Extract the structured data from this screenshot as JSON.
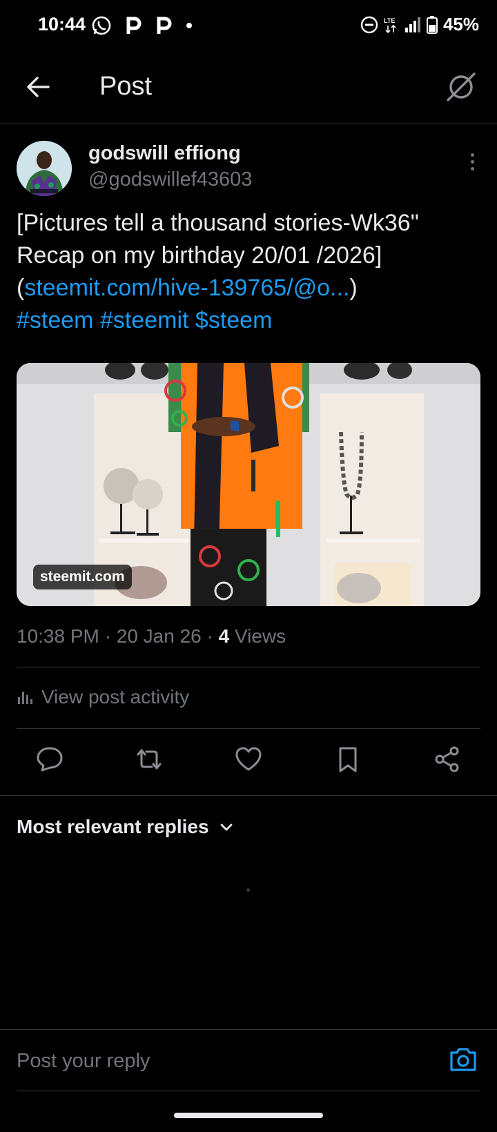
{
  "status_bar": {
    "time": "10:44",
    "battery_percent": "45%",
    "icons": [
      "whatsapp-icon",
      "p-app-icon",
      "p-app-icon",
      "notification-dot",
      "dnd-icon",
      "lte-icon",
      "signal-icon",
      "battery-icon"
    ]
  },
  "header": {
    "title": "Post",
    "back_icon": "arrow-left-icon",
    "grok_icon": "grok-icon"
  },
  "author": {
    "name": "godswill effiong",
    "handle": "@godswillef43603"
  },
  "post": {
    "text_part1": "[Pictures tell a thousand stories-Wk36\" Recap on my birthday 20/01 /2026](",
    "link_text": "steemit.com/hive-139765/@o...",
    "text_part2": ")",
    "hashtag1": "#steem",
    "hashtag2": "#steemit",
    "cashtag": "$steem",
    "media_label": "steemit.com"
  },
  "meta": {
    "time": "10:38 PM",
    "date": "20 Jan 26",
    "views_count": "4",
    "views_label": "Views",
    "separator": "·"
  },
  "activity": {
    "label": "View post activity"
  },
  "actions": [
    "reply-icon",
    "repost-icon",
    "like-icon",
    "bookmark-icon",
    "share-icon"
  ],
  "replies": {
    "sort_label": "Most relevant replies"
  },
  "composer": {
    "placeholder": "Post your reply"
  },
  "colors": {
    "background": "#000000",
    "link": "#1d9bf0",
    "muted": "#71767b",
    "divider": "#2f3336"
  }
}
